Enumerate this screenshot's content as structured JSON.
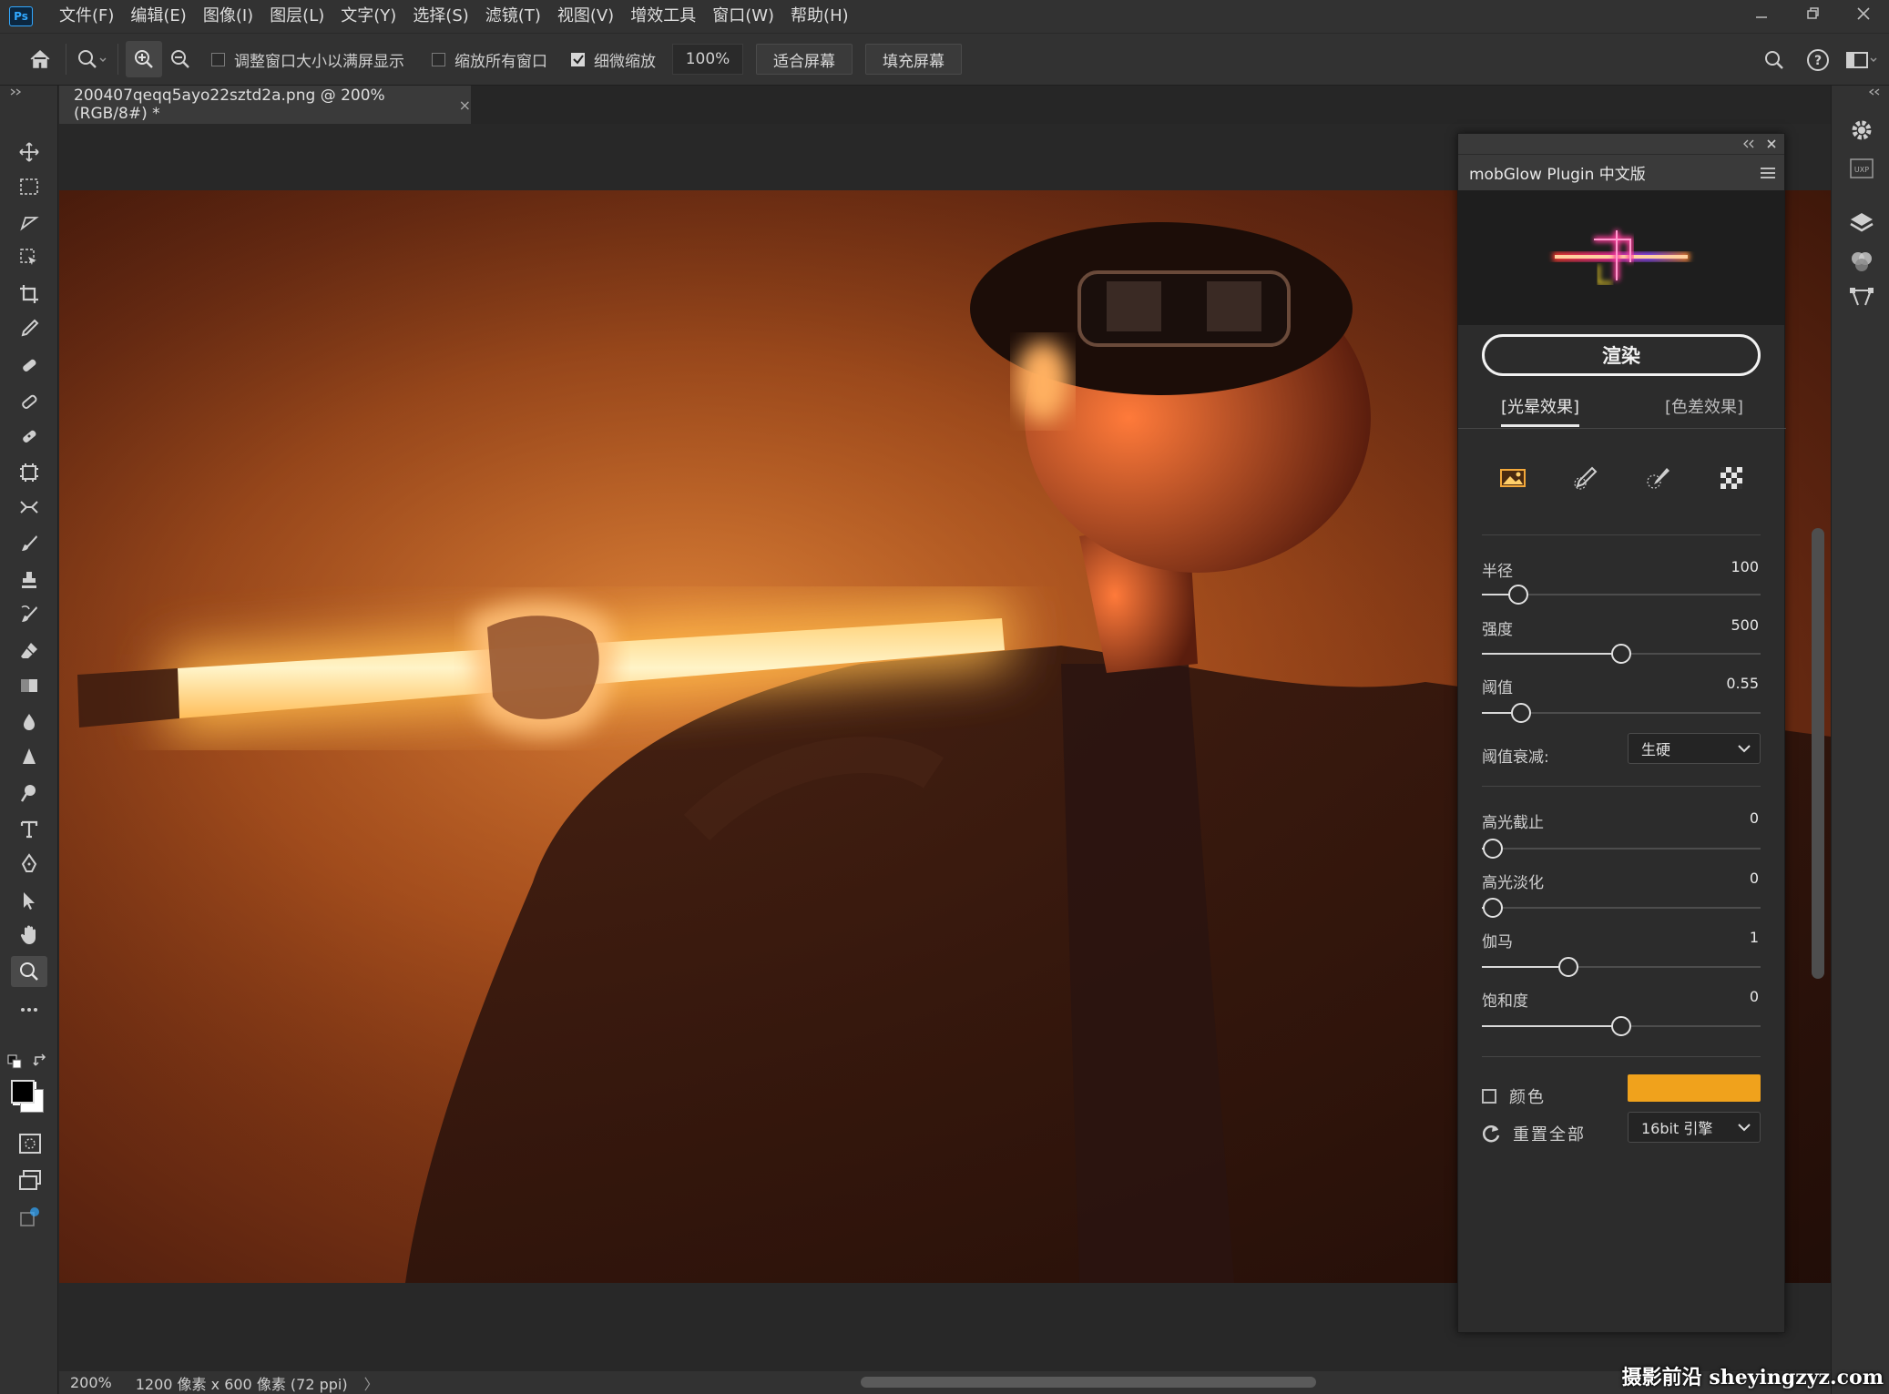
{
  "app": {
    "logo": "Ps"
  },
  "menu": [
    "文件(F)",
    "编辑(E)",
    "图像(I)",
    "图层(L)",
    "文字(Y)",
    "选择(S)",
    "滤镜(T)",
    "视图(V)",
    "增效工具",
    "窗口(W)",
    "帮助(H)"
  ],
  "options": {
    "resize_windows": "调整窗口大小以满屏显示",
    "zoom_all": "缩放所有窗口",
    "scrubby_zoom": "细微缩放",
    "zoom_value": "100%",
    "fit_screen": "适合屏幕",
    "fill_screen": "填充屏幕"
  },
  "document": {
    "tab_title": "200407qeqq5ayo22sztd2a.png @ 200%(RGB/8#) *",
    "close_glyph": "×"
  },
  "status": {
    "zoom": "200%",
    "info": "1200 像素 x 600 像素 (72 ppi)",
    "arrow": "〉"
  },
  "panel": {
    "title": "mobGlow Plugin 中文版",
    "render_label": "渲染",
    "tabs": [
      "[光晕效果]",
      "[色差效果]"
    ],
    "active_tab": 0,
    "sliders": [
      {
        "label": "半径",
        "value": "100",
        "level": 0.13
      },
      {
        "label": "强度",
        "value": "500",
        "level": 0.5
      },
      {
        "label": "阈值",
        "value": "0.55",
        "level": 0.14
      },
      {
        "label": "高光截止",
        "value": "0",
        "level": 0.04
      },
      {
        "label": "高光淡化",
        "value": "0",
        "level": 0.04
      },
      {
        "label": "伽马",
        "value": "1",
        "level": 0.31
      },
      {
        "label": "饱和度",
        "value": "0",
        "level": 0.5
      }
    ],
    "falloff_label": "阈值衰减:",
    "falloff_value": "生硬",
    "color_label": "颜色",
    "color_value": "#f0a21c",
    "reset_label": "重置全部",
    "engine_value": "16bit 引擎"
  },
  "watermark": "摄影前沿 sheyingzyz.com",
  "colors": {
    "accent": "#31a8ff",
    "glow": "#ffb84a"
  },
  "icons": {
    "toolbar": [
      "move-icon",
      "marquee-icon",
      "lasso-icon",
      "object-select-icon",
      "crop-icon",
      "eyedropper-icon",
      "spot-heal-icon",
      "heal-icon",
      "patch-icon",
      "content-aware-icon",
      "red-eye-icon",
      "brush-icon",
      "stamp-icon",
      "history-brush-icon",
      "eraser-icon",
      "gradient-icon",
      "blur-icon",
      "sharpen-icon",
      "dodge-icon",
      "type-icon",
      "pen-icon",
      "path-select-icon",
      "hand-icon",
      "zoom-icon",
      "more-tools-icon"
    ]
  }
}
